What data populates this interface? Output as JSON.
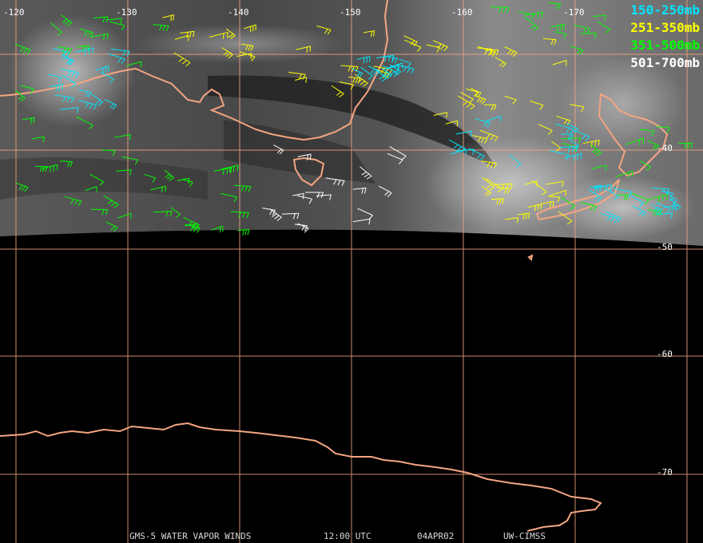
{
  "map": {
    "longitude_labels": [
      "-120",
      "-130",
      "-140",
      "-150",
      "-160",
      "-170"
    ],
    "latitude_labels": [
      "-40",
      "-50",
      "-60",
      "-70"
    ]
  },
  "legend": [
    {
      "label": "150-250mb",
      "color": "#00e5ff"
    },
    {
      "label": "251-350mb",
      "color": "#ffff00"
    },
    {
      "label": "351-500mb",
      "color": "#00ff00"
    },
    {
      "label": "501-700mb",
      "color": "#ffffff"
    }
  ],
  "footer": {
    "title": "GMS-5 WATER VAPOR WINDS",
    "time": "12:00 UTC",
    "date": "04APR02",
    "source": "UW-CIMSS"
  },
  "colors": {
    "coastline": "#f4a582",
    "grid": "#f4a582",
    "background": "#000000"
  }
}
